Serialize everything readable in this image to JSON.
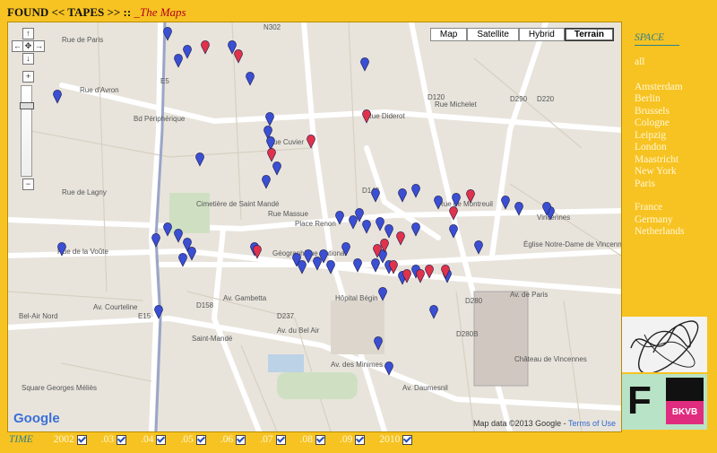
{
  "header": {
    "title": "FOUND << TAPES >> ::",
    "subtitle": "_The Maps"
  },
  "map": {
    "types": [
      "Map",
      "Satellite",
      "Hybrid",
      "Terrain"
    ],
    "active_type": "Terrain",
    "zoom_controls": {
      "up": "↑",
      "left": "←",
      "home": "✥",
      "right": "→",
      "down": "↓",
      "zoom_in": "+",
      "zoom_out": "−"
    },
    "logo": "Google",
    "attribution": "Map data ©2013 Google",
    "terms": "Terms of Use",
    "labels": [
      "Rue de Paris",
      "Rue d'Avron",
      "Rue Diderot",
      "Rue Michelet",
      "Rue Cuvier",
      "Rue de Lagny",
      "Rue Massue",
      "Place Renon",
      "Rue de Montreuil",
      "Vincennes",
      "Saint-Mandé",
      "Rue de la Voûte",
      "Av. Courteline",
      "Av. du Bel Air",
      "Av. des Minimes",
      "Av. de Paris",
      "Av. Gambetta",
      "Bd Périphérique",
      "Château de Vincennes",
      "Cimetière de Saint Mandé",
      "Géographique National",
      "Hôpital Bégin",
      "Église Notre-Dame de Vincennes",
      "Bel-Air Nord",
      "Square Georges Méliès",
      "Av. Daumesnil",
      "E15",
      "D143",
      "D120",
      "D158",
      "D237",
      "D280",
      "D280B",
      "N302",
      "D290",
      "D220",
      "E5"
    ],
    "marker_colors": {
      "blue": "#3b4fd3",
      "red": "#e0324a"
    }
  },
  "space": {
    "heading": "SPACE",
    "all": "all",
    "cities": [
      "Amsterdam",
      "Berlin",
      "Brussels",
      "Cologne",
      "Leipzig",
      "London",
      "Maastricht",
      "New York",
      "Paris"
    ],
    "countries": [
      "France",
      "Germany",
      "Netherlands"
    ]
  },
  "time": {
    "heading": "TIME",
    "years": [
      "2002",
      ".03",
      ".04",
      ".05",
      ".06",
      ".07",
      ".08",
      ".09",
      "2010"
    ]
  },
  "sponsor": {
    "letter": "F",
    "brand": "BKVB"
  }
}
